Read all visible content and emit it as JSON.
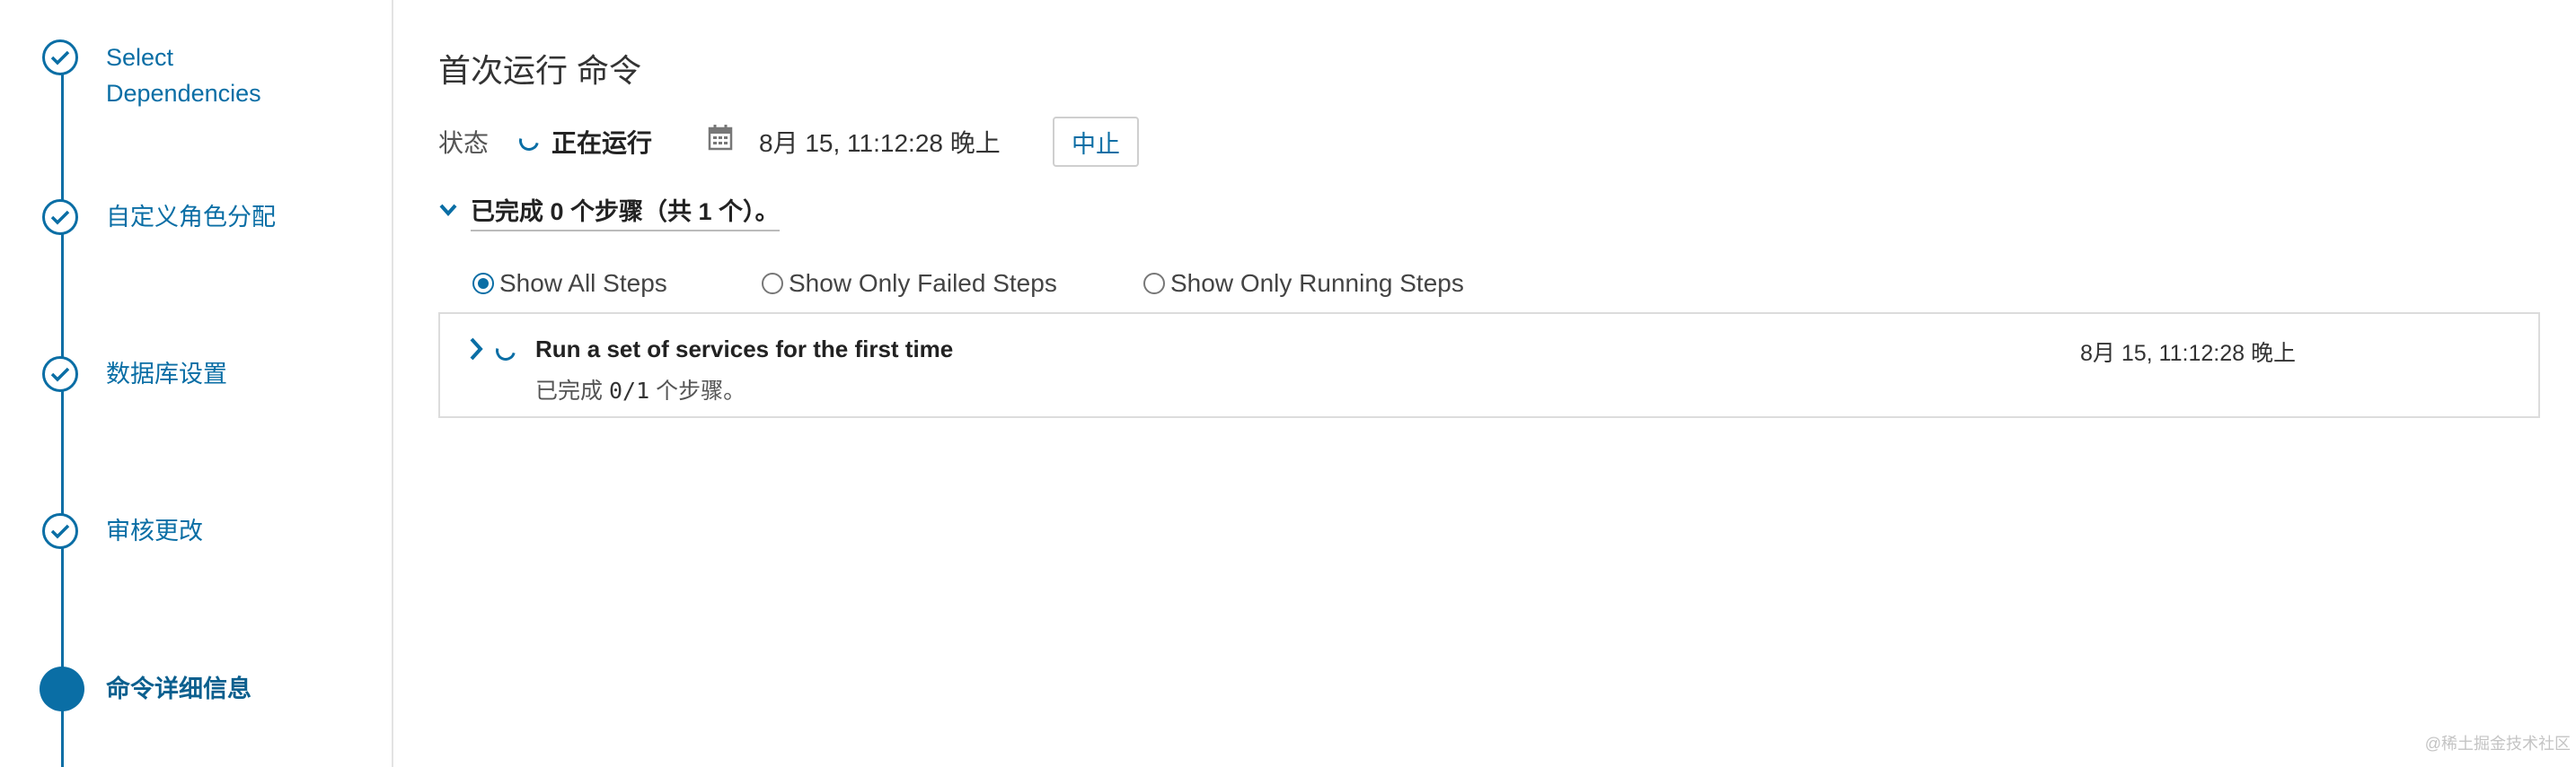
{
  "wizard": {
    "steps": [
      {
        "label_line1": "Select",
        "label_line2": "Dependencies",
        "state": "done"
      },
      {
        "label": "自定义角色分配",
        "state": "done"
      },
      {
        "label": "数据库设置",
        "state": "done"
      },
      {
        "label": "审核更改",
        "state": "done"
      },
      {
        "label": "命令详细信息",
        "state": "active"
      }
    ]
  },
  "main": {
    "title": "首次运行 命令",
    "status": {
      "label": "状态",
      "value": "正在运行",
      "time": "8月 15, 11:12:28 晚上",
      "abort_label": "中止"
    },
    "summary": "已完成 0 个步骤（共 1 个）。",
    "filters": [
      {
        "label": "Show All Steps",
        "checked": true
      },
      {
        "label": "Show Only Failed Steps",
        "checked": false
      },
      {
        "label": "Show Only Running Steps",
        "checked": false
      }
    ],
    "steps": [
      {
        "name": "Run a set of services for the first time",
        "time": "8月 15, 11:12:28 晚上",
        "progress_prefix": "已完成",
        "progress_count": "0/1",
        "progress_suffix": "个步骤。"
      }
    ]
  },
  "watermark": "@稀土掘金技术社区",
  "colors": {
    "accent": "#0a6ea5",
    "border": "#dcdcdc",
    "text": "#333333"
  },
  "icons": [
    "check-icon",
    "spinner-icon",
    "calendar-icon",
    "chevron-down-icon",
    "chevron-right-icon",
    "radio-icon"
  ]
}
